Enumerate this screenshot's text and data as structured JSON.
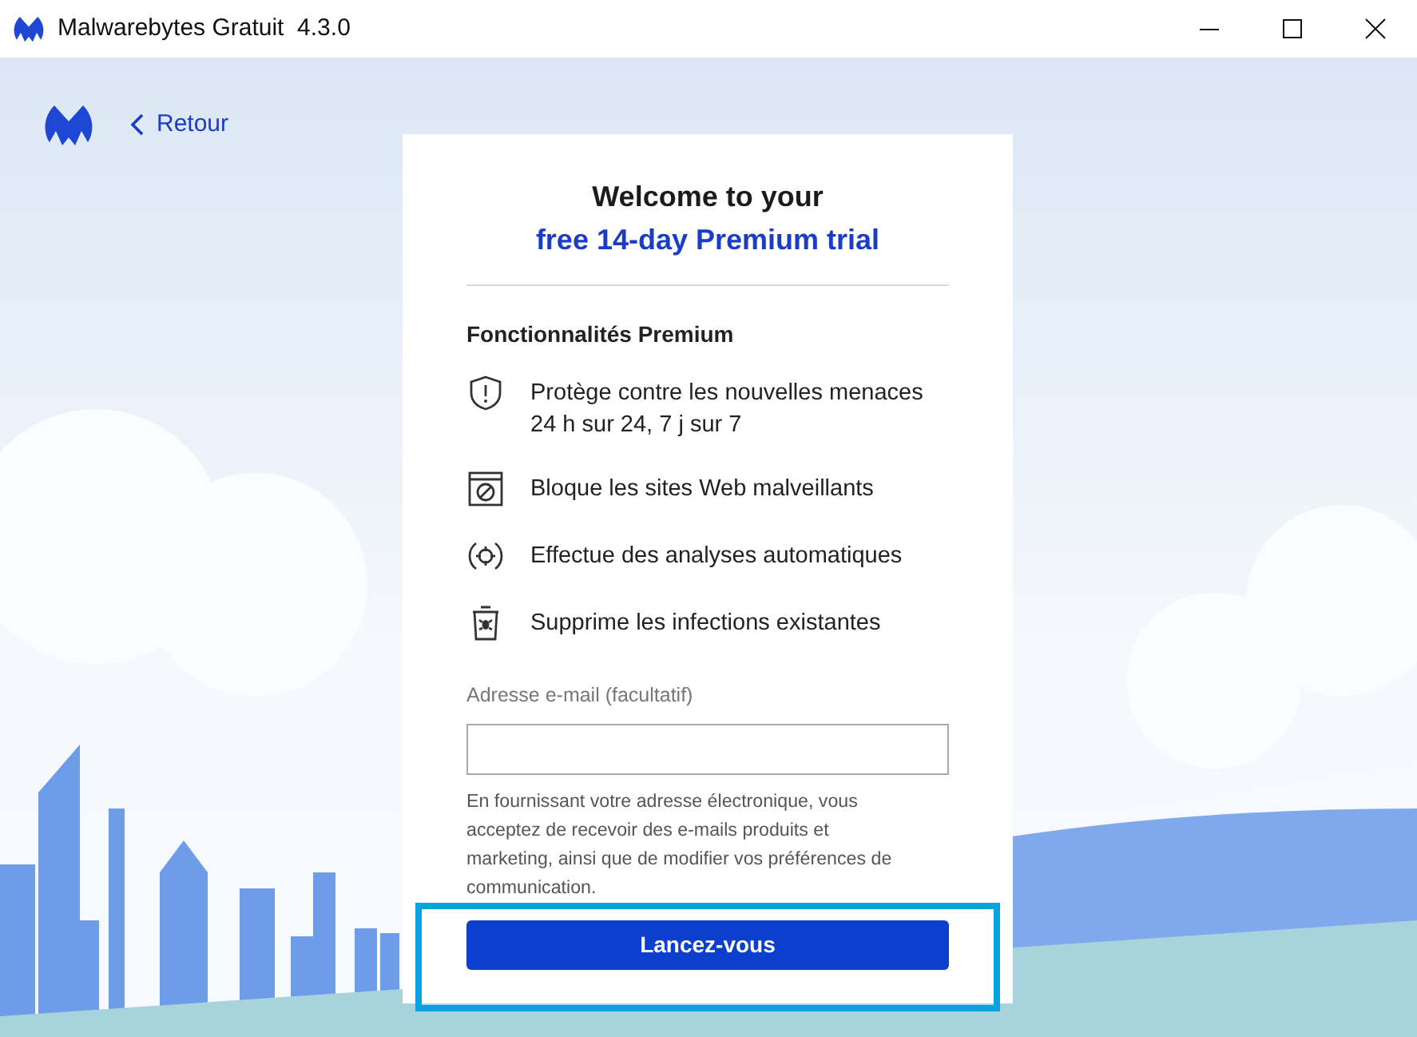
{
  "window": {
    "title": "Malwarebytes Gratuit  4.3.0"
  },
  "back_link": {
    "label": "Retour"
  },
  "card": {
    "title_line_1": "Welcome to your",
    "title_line_2": "free 14-day Premium trial",
    "features_heading": "Fonctionnalités Premium",
    "features": [
      {
        "kind": "shield",
        "text": "Protège contre les nouvelles menaces\n24 h sur 24, 7 j sur 7"
      },
      {
        "kind": "block",
        "text": "Bloque les sites Web malveillants"
      },
      {
        "kind": "scan",
        "text": "Effectue des analyses automatiques"
      },
      {
        "kind": "trash",
        "text": "Supprime les infections existantes"
      }
    ],
    "email_label": "Adresse e-mail (facultatif)",
    "notice": "En fournissant votre adresse électronique, vous acceptez de recevoir des e-mails produits et marketing, ainsi que de modifier vos préférences de communication.",
    "button": {
      "label": "Lancez-vous",
      "highlighted": true
    }
  }
}
